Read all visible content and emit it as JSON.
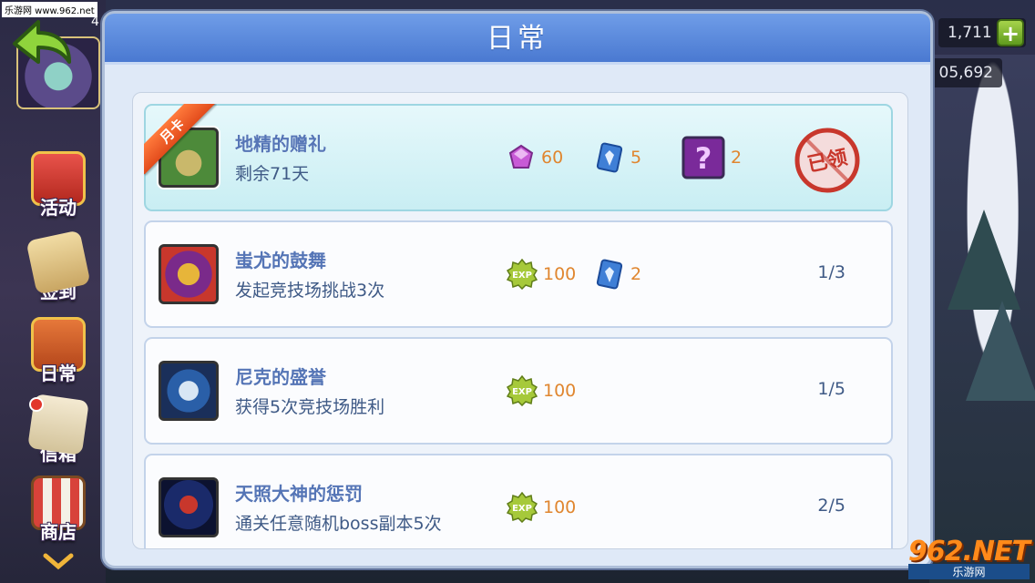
{
  "watermark": {
    "top_left": "乐游网 www.962.net",
    "bottom_right_big": "962.NET",
    "bottom_right_small": "乐游网"
  },
  "player": {
    "level_fragment": "4"
  },
  "resources": {
    "gems": "1,711",
    "gold": "05,692",
    "add_label": "+"
  },
  "sidebar": {
    "items": [
      {
        "label": "活动",
        "icon": "gift-icon"
      },
      {
        "label": "签到",
        "icon": "scroll-icon"
      },
      {
        "label": "日常",
        "icon": "book-icon"
      },
      {
        "label": "信箱",
        "icon": "mail-icon",
        "has_badge": true
      },
      {
        "label": "商店",
        "icon": "shop-icon"
      }
    ]
  },
  "panel": {
    "title": "日常"
  },
  "tasks": [
    {
      "ribbon": "月卡",
      "title": "地精的赠礼",
      "subtitle": "剩余71天",
      "thumb_colors": [
        "#4d8a3a",
        "#c9b86b"
      ],
      "rewards": [
        {
          "icon": "crystal-icon",
          "amount": "60"
        },
        {
          "icon": "card-icon",
          "amount": "5"
        },
        {
          "icon": "mystery-box-icon",
          "amount": "2"
        }
      ],
      "status": "已领"
    },
    {
      "title": "蚩尤的鼓舞",
      "subtitle": "发起竞技场挑战3次",
      "thumb_colors": [
        "#7a2a8a",
        "#e7b53a"
      ],
      "rewards": [
        {
          "icon": "exp-icon",
          "amount": "100"
        },
        {
          "icon": "card-icon",
          "amount": "2"
        }
      ],
      "progress": "1/3"
    },
    {
      "title": "尼克的盛誉",
      "subtitle": "获得5次竞技场胜利",
      "thumb_colors": [
        "#2a5fa8",
        "#d8e6f4"
      ],
      "rewards": [
        {
          "icon": "exp-icon",
          "amount": "100"
        }
      ],
      "progress": "1/5"
    },
    {
      "title": "天照大神的惩罚",
      "subtitle": "通关任意随机boss副本5次",
      "thumb_colors": [
        "#1a2a6a",
        "#c8372c"
      ],
      "rewards": [
        {
          "icon": "exp-icon",
          "amount": "100"
        }
      ],
      "progress": "2/5"
    }
  ]
}
